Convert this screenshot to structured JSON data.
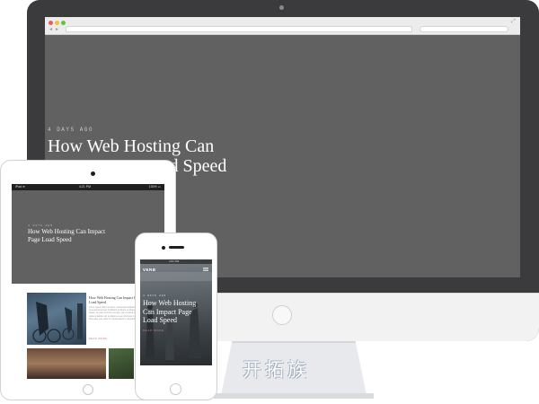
{
  "desktop": {
    "browser": {
      "url": "",
      "search_placeholder": "",
      "nav_back": "◂",
      "nav_forward": "▸"
    },
    "post": {
      "meta": "4 DAYS AGO",
      "title": "How Web Hosting Can Impact Page Load Speed"
    }
  },
  "tablet": {
    "status": {
      "carrier": "iPad ≋",
      "time": "4:21 PM",
      "battery": "100% ▭"
    },
    "hero": {
      "meta": "4 DAYS AGO",
      "title": "How Web Hosting Can Impact Page Load Speed"
    },
    "article": {
      "title": "How Web Hosting Can Impact Page Load Speed",
      "body": "Lorem ipsum dolor sit amet, consectetur adipiscing elit. Sed do eiusmod tempor incididunt ut labore et dolore magna aliqua. Ut enim ad minim veniam, quis nostrud exercitation ullamco laboris nisi ut aliquip ex ea commodo consequat. Duis aute irure dolor in reprehenderit in voluptate.",
      "more": "READ MORE"
    }
  },
  "phone": {
    "status": {
      "time": "4:21 PM"
    },
    "logo": "VERB",
    "meta": "4 DAYS AGO",
    "title": "How Web Hosting Can Impact Page Load Speed",
    "more": "READ MORE"
  },
  "watermark": "开拓族",
  "colors": {
    "imac_frame": "#3b3b3d",
    "screen_bg": "#616161",
    "accent_red": "#d36b6b"
  }
}
